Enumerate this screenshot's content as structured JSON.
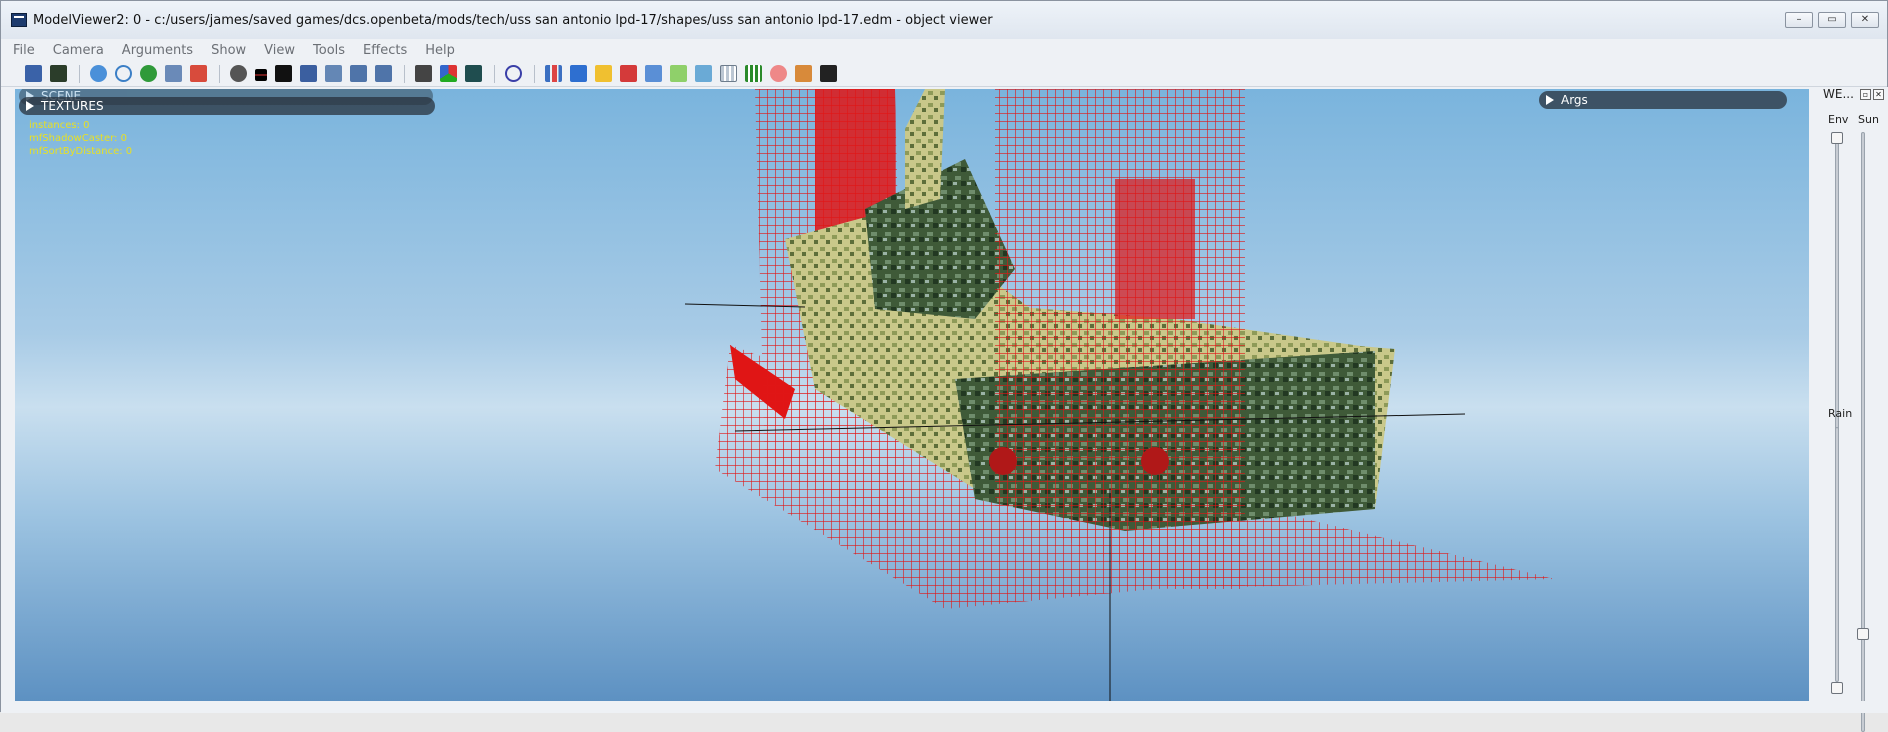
{
  "window": {
    "title": "ModelViewer2: 0 - c:/users/james/saved games/dcs.openbeta/mods/tech/uss san antonio lpd-17/shapes/uss san antonio lpd-17.edm - object viewer",
    "minimize": "–",
    "maximize": "▭",
    "close": "✕"
  },
  "menu": [
    "File",
    "Camera",
    "Arguments",
    "Show",
    "View",
    "Tools",
    "Effects",
    "Help"
  ],
  "viewport": {
    "scene_label": "SCENE",
    "textures_label": "TEXTURES",
    "args_label": "Args",
    "stats": [
      "instances: 0",
      "mfShadowCaster: 0",
      "mfSortByDistance: 0"
    ]
  },
  "right_panel": {
    "title": "WE...",
    "btn_float": "▫",
    "btn_close": "✕",
    "env_label": "Env",
    "sun_label": "Sun",
    "rain_label": "Rain"
  },
  "colors": {
    "wire": "#e01515",
    "hull_green": "#3f5a38",
    "hull_light": "#c9c88a",
    "stats_text": "#e8e024"
  }
}
